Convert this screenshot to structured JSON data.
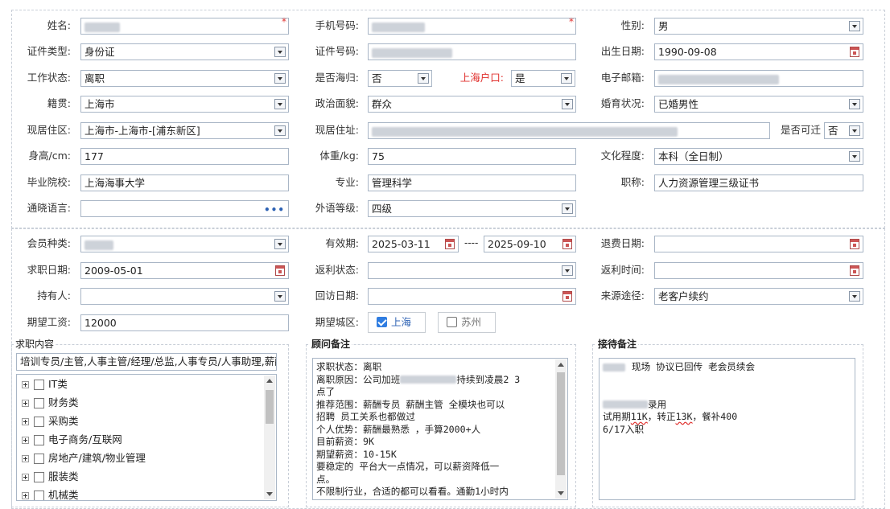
{
  "row1": {
    "name_label": "姓名:",
    "phone_label": "手机号码:",
    "gender_label": "性别:",
    "gender_value": "男",
    "required_mark": "*"
  },
  "row2": {
    "idtype_label": "证件类型:",
    "idtype_value": "身份证",
    "idno_label": "证件号码:",
    "birth_label": "出生日期:",
    "birth_value": "1990-09-08"
  },
  "row3": {
    "workstatus_label": "工作状态:",
    "workstatus_value": "离职",
    "overseas_label": "是否海归:",
    "overseas_value": "否",
    "hukou_label": "上海户口:",
    "hukou_value": "是",
    "email_label": "电子邮箱:"
  },
  "row4": {
    "native_label": "籍贯:",
    "native_value": "上海市",
    "political_label": "政治面貌:",
    "political_value": "群众",
    "marital_label": "婚育状况:",
    "marital_value": "已婚男性"
  },
  "row5": {
    "residence_label": "现居住区:",
    "residence_value": "上海市-上海市-[浦东新区]",
    "address_label": "现居住址:",
    "relocate_label": "是否可迁",
    "relocate_value": "否"
  },
  "row6": {
    "height_label": "身高/cm:",
    "height_value": "177",
    "weight_label": "体重/kg:",
    "weight_value": "75",
    "education_label": "文化程度:",
    "education_value": "本科（全日制）"
  },
  "row7": {
    "school_label": "毕业院校:",
    "school_value": "上海海事大学",
    "major_label": "专业:",
    "major_value": "管理科学",
    "title_label": "职称:",
    "title_value": "人力资源管理三级证书"
  },
  "row8": {
    "language_label": "通晓语言:",
    "language_more": "•••",
    "foreign_label": "外语等级:",
    "foreign_value": "四级"
  },
  "row9": {
    "member_label": "会员种类:",
    "validity_label": "有效期:",
    "validity_start": "2025-03-11",
    "validity_sep": "----",
    "validity_end": "2025-09-10",
    "refund_label": "退费日期:"
  },
  "row10": {
    "jobdate_label": "求职日期:",
    "jobdate_value": "2009-05-01",
    "rebate_status_label": "返利状态:",
    "rebate_time_label": "返利时间:"
  },
  "row11": {
    "holder_label": "持有人:",
    "visit_label": "回访日期:",
    "source_label": "来源途径:",
    "source_value": "老客户续约"
  },
  "row12": {
    "salary_label": "期望工资:",
    "salary_value": "12000",
    "city_label": "期望城区:",
    "city_options": [
      "上海",
      "苏州"
    ]
  },
  "job_panel": {
    "title": "求职内容",
    "selected_text": "培训专员/主管,人事主管/经理/总监,人事专员/人事助理,薪酬",
    "categories": [
      "IT类",
      "财务类",
      "采购类",
      "电子商务/互联网",
      "房地产/建筑/物业管理",
      "服装类",
      "机械类"
    ]
  },
  "advisor_panel": {
    "title": "顾问备注",
    "lines": [
      "求职状态：离职",
      "离职原因：公司加班",
      "持续到凌晨2 3",
      "点了",
      "推荐范围：薪酬专员 薪酬主管 全模块也可以",
      "招聘 员工关系也都做过",
      "个人优势：薪酬最熟悉 ，手算2000+人",
      "目前薪资：9K",
      "期望薪资：10-15K",
      "要稳定的 平台大一点情况，可以薪资降低一",
      "点。",
      "不限制行业，合适的都可以看看。通勤1小时内"
    ]
  },
  "reception_panel": {
    "title": "接待备注",
    "line1": "现场 协议已回传 老会员续会",
    "line2": "录用",
    "line3a": "试用期",
    "line3b": "11K",
    "line3c": "，转正",
    "line3d": "13K",
    "line3e": "，餐补400",
    "line4": "6/17入职"
  }
}
